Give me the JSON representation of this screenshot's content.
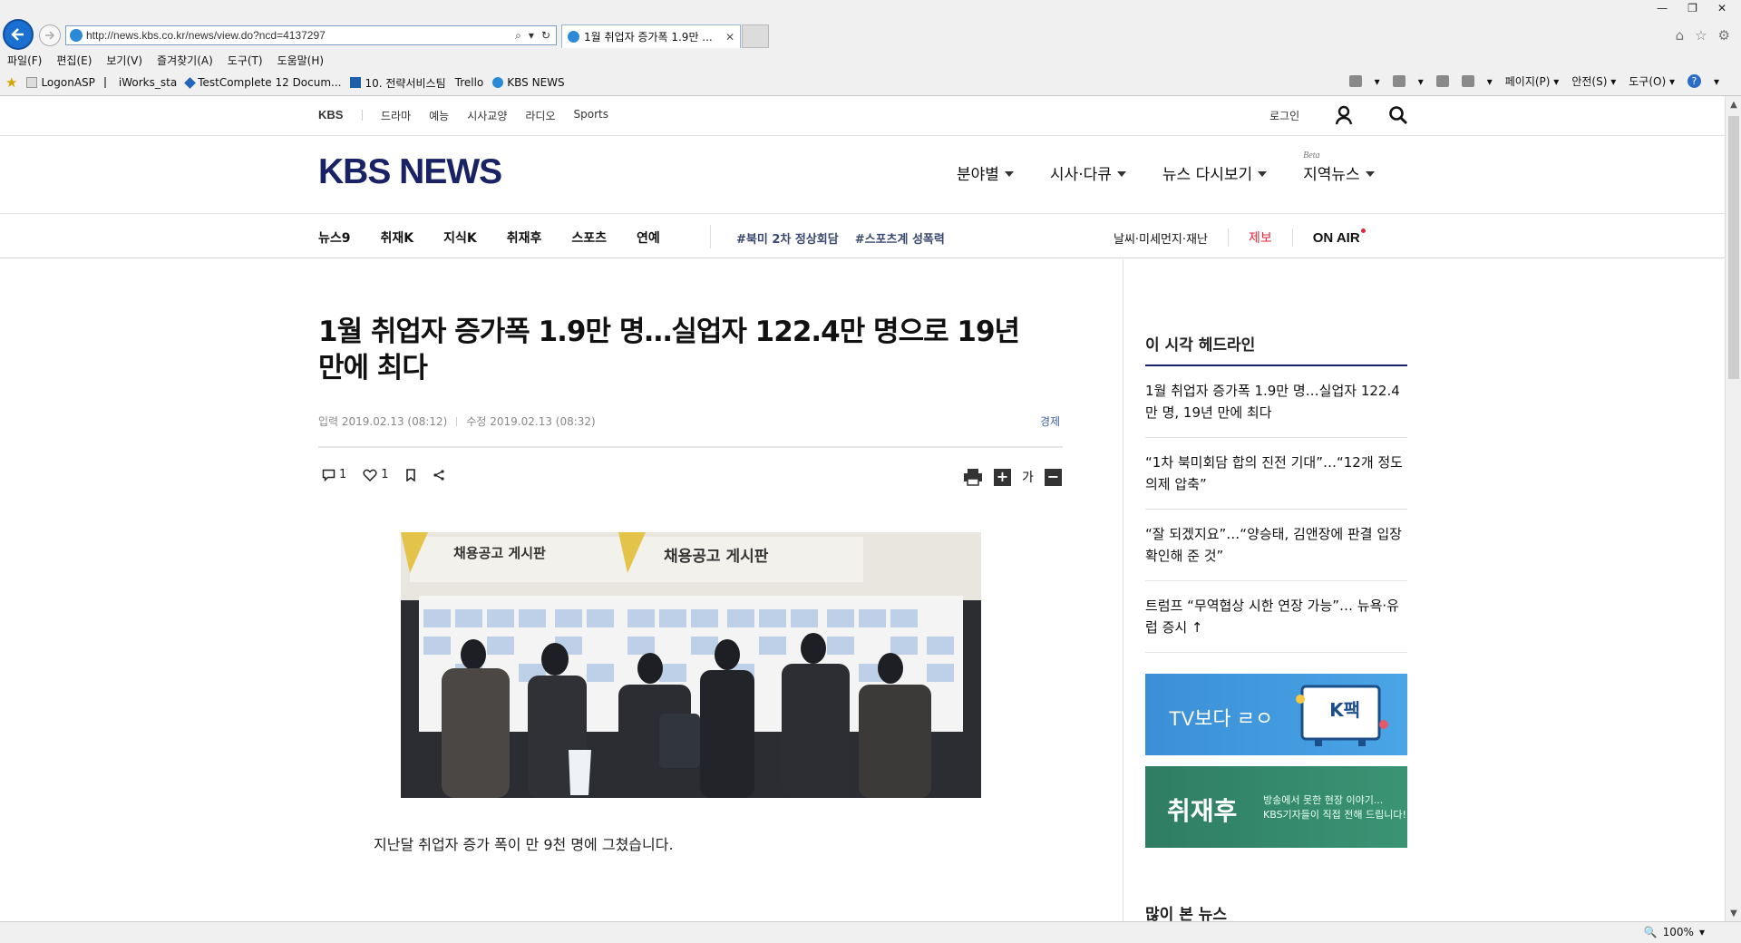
{
  "browser": {
    "url": "http://news.kbs.co.kr/news/view.do?ncd=4137297",
    "tab_title": "1월 취업자 증가폭 1.9만 ...",
    "menu": [
      "파일(F)",
      "편집(E)",
      "보기(V)",
      "즐겨찾기(A)",
      "도구(T)",
      "도움말(H)"
    ],
    "favorites": [
      "LogonASP",
      "iWorks_sta",
      "TestComplete 12 Docum...",
      "10. 전략서비스팀",
      "Trello",
      "KBS NEWS"
    ],
    "commands": [
      "페이지(P)",
      "안전(S)",
      "도구(O)"
    ],
    "zoom": "100%"
  },
  "topbar": {
    "brand": "KBS",
    "categories": [
      "드라마",
      "예능",
      "시사교양",
      "라디오",
      "Sports"
    ],
    "login": "로그인"
  },
  "header": {
    "logo": "KBS NEWS",
    "nav": [
      "분야별",
      "시사·다큐",
      "뉴스 다시보기",
      "지역뉴스"
    ],
    "beta": "Beta"
  },
  "subnav": {
    "items": [
      "뉴스9",
      "취재K",
      "지식K",
      "취재후",
      "스포츠",
      "연예"
    ],
    "tags": [
      "#북미 2차 정상회담",
      "#스포츠계 성폭력"
    ],
    "weather": "날씨·미세먼지·재난",
    "tip": "제보",
    "onair": "ON AIR"
  },
  "article": {
    "title": "1월 취업자 증가폭 1.9만 명…실업자 122.4만 명으로 19년 만에 최다",
    "input_date": "입력 2019.02.13 (08:12)",
    "edit_date": "수정 2019.02.13 (08:32)",
    "category": "경제",
    "comments": "1",
    "likes": "1",
    "font_label": "가",
    "photo_sign_left": "채용공고 게시판",
    "photo_sign_right": "채용공고 게시판",
    "body_first_line": "지난달 취업자 증가 폭이 만 9천 명에 그쳤습니다."
  },
  "sidebar": {
    "headline_title": "이 시각 헤드라인",
    "headlines": [
      "1월 취업자 증가폭 1.9만 명…실업자 122.4만 명, 19년 만에 최다",
      "“1차 북미회담 합의 진전 기대”…“12개 정도 의제 압축”",
      "“잘 되겠지요”…“양승태, 김앤장에 판결 입장 확인해 준 것”",
      "트럼프 “무역협상 시한 연장 가능”… 뉴욕·유럽 증시 ↑"
    ],
    "banner1_text": "TV보다 ㄹㅇ",
    "banner1_logo": "K팩",
    "banner2_big": "취재후",
    "banner2_small_1": "방송에서 못한 현장 이야기...",
    "banner2_small_2": "KBS기자들이 직접 전해 드립니다!",
    "popular_title": "많이 본 뉴스"
  },
  "colors": {
    "kbs_navy": "#1a2266",
    "tip_red": "#e0283a",
    "category_blue": "#3c5ea9"
  }
}
